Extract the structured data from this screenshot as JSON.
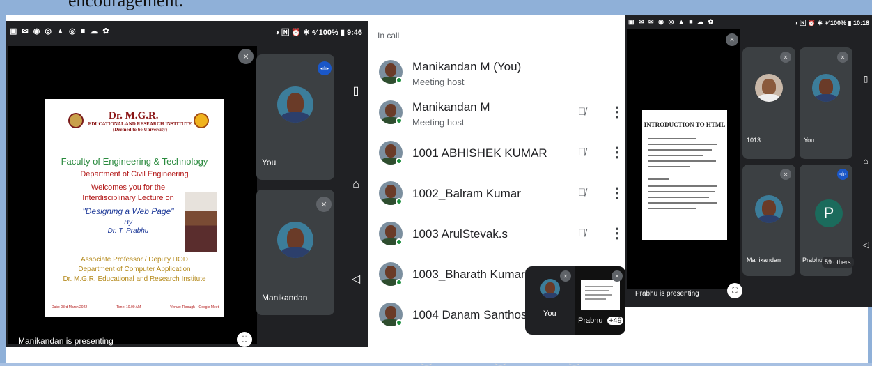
{
  "caption_fragment": "encouragement.",
  "phone1": {
    "status_icons": "▣ ✉ ◉ ◎ ▲ ◎ ■ ☁ ✿",
    "status_right": "◑ 🄽 ⏰ ✱ ⁴⁄ 100% ▮ 9:46",
    "slide": {
      "institute": "Dr. M.G.R.",
      "institute_sub": "EDUCATIONAL AND RESEARCH INSTITUTE (Deemed to be University)",
      "faculty": "Faculty of Engineering & Technology",
      "department": "Department of Civil Engineering",
      "welcome": "Welcomes you for the",
      "lecture": "Interdisciplinary Lecture on",
      "topic": "\"Designing a Web Page\"",
      "by": "By",
      "speaker": "Dr. T. Prabhu",
      "designation": "Associate Professor / Deputy HOD",
      "speaker_dept": "Department of Computer Application",
      "speaker_inst": "Dr. M.G.R. Educational and Research Institute",
      "date": "Date: 03rd March 2022",
      "time": "Time: 10.00 AM",
      "venue": "Venue: Through – Google Meet"
    },
    "presenting_label": "Manikandan is presenting",
    "tiles": [
      {
        "label": "You"
      },
      {
        "label": "Manikandan"
      }
    ]
  },
  "participants": {
    "header": "In call",
    "rows": [
      {
        "name": "Manikandan M (You)",
        "role": "Meeting host",
        "muted": false
      },
      {
        "name": "Manikandan M",
        "role": "Meeting host",
        "muted": true
      },
      {
        "name": "1001 ABHISHEK KUMAR",
        "role": "",
        "muted": true
      },
      {
        "name": "1002_Balram Kumar",
        "role": "",
        "muted": true
      },
      {
        "name": "1003 ArulStevak.s",
        "role": "",
        "muted": true
      },
      {
        "name": "1003_Bharath Kumar",
        "role": "",
        "muted": false
      },
      {
        "name": "1004 Danam Santhosh",
        "role": "",
        "muted": false
      }
    ],
    "pip": {
      "you_label": "You",
      "presenter_label": "Prabhu",
      "others_count": "+49"
    }
  },
  "phone2": {
    "status_icons": "▣ ✉ ✉ ◉ ◎ ▲ ■ ☁ ✿",
    "status_right": "◑ 🄽 ⏰ ✱ ⁴⁄ 100% ▮ 10:18",
    "slide_title": "INTRODUCTION TO HTML",
    "presenting_label": "Prabhu is presenting",
    "tiles": [
      {
        "label": "1013"
      },
      {
        "label": "You"
      },
      {
        "label": "Manikandan"
      },
      {
        "label": "Prabhu"
      }
    ],
    "avatar_letter": "P",
    "others": "59 others"
  },
  "colors": {
    "frame": "#8fb0d8",
    "meet_bg": "#202124",
    "tile_bg": "#3c4043",
    "online_dot": "#1e8e3e",
    "speaking": "#1a57c8"
  }
}
